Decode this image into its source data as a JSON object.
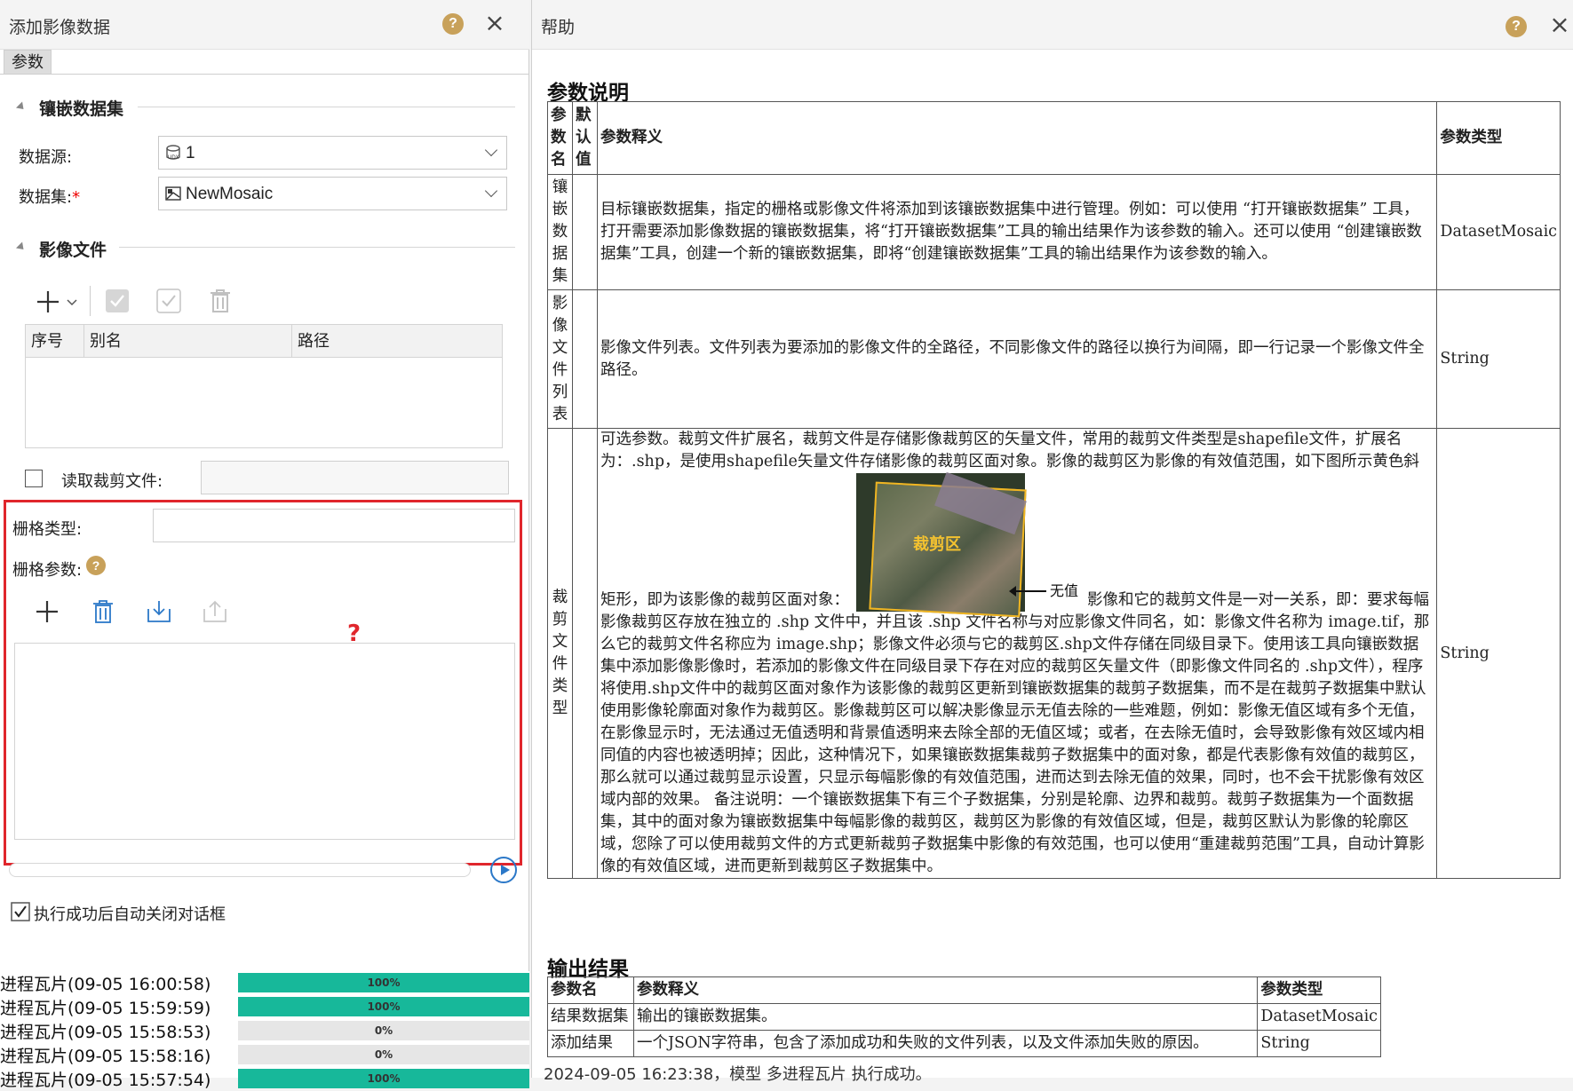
{
  "dialog": {
    "title": "添加影像数据",
    "tab": "参数",
    "mosaic_section": "镶嵌数据集",
    "datasource_label": "数据源:",
    "datasource_value": "1",
    "datasource_icon": "udx-datasource-icon",
    "dataset_label": "数据集:",
    "dataset_required": "*",
    "dataset_value": "NewMosaic",
    "dataset_icon": "mosaic-dataset-icon",
    "image_section": "影像文件",
    "file_grid_columns": [
      "序号",
      "别名",
      "路径"
    ],
    "read_clip_label": "读取裁剪文件:",
    "raster_type_label": "栅格类型:",
    "raster_params_label": "栅格参数:",
    "annotation_mark": "?",
    "auto_close_label": "执行成功后自动关闭对话框"
  },
  "tasks": [
    {
      "name": "进程瓦片(09-05 16:00:58)",
      "progress": 100,
      "label": "100%"
    },
    {
      "name": "进程瓦片(09-05 15:59:59)",
      "progress": 100,
      "label": "100%"
    },
    {
      "name": "进程瓦片(09-05 15:58:53)",
      "progress": 0,
      "label": "0%"
    },
    {
      "name": "进程瓦片(09-05 15:58:16)",
      "progress": 0,
      "label": "0%"
    },
    {
      "name": "进程瓦片(09-05 15:57:54)",
      "progress": 100,
      "label": "100%"
    }
  ],
  "help": {
    "title": "帮助",
    "params_heading": "参数说明",
    "params_headers": [
      "参数名",
      "默认值",
      "参数释义",
      "参数类型"
    ],
    "params": [
      {
        "name": "镶嵌数据集",
        "default": "",
        "type": "DatasetMosaic",
        "desc": "目标镶嵌数据集，指定的栅格或影像文件将添加到该镶嵌数据集中进行管理。例如：可以使用 “打开镶嵌数据集” 工具，打开需要添加影像数据的镶嵌数据集，将“打开镶嵌数据集”工具的输出结果作为该参数的输入。还可以使用 “创建镶嵌数据集”工具，创建一个新的镶嵌数据集，即将“创建镶嵌数据集”工具的输出结果作为该参数的输入。"
      },
      {
        "name": "影像文件列表",
        "default": "",
        "type": "String",
        "desc": "影像文件列表。文件列表为要添加的影像文件的全路径，不同影像文件的路径以换行为间隔，即一行记录一个影像文件全路径。"
      },
      {
        "name": "裁剪文件类型",
        "default": "",
        "type": "String",
        "desc_before": "可选参数。裁剪文件扩展名，裁剪文件是存储影像裁剪区的矢量文件，常用的裁剪文件类型是shapefile文件，扩展名为：.shp，是使用shapefile矢量文件存储影像的裁剪区面对象。影像的裁剪区为影像的有效值范围，如下图所示黄色斜矩形，即为该影像的裁剪区面对象：",
        "figure_label": "裁剪区",
        "figure_callout": "无值",
        "desc_after": "影像和它的裁剪文件是一对一关系，即：要求每幅影像裁剪区存放在独立的 .shp 文件中，并且该 .shp 文件名称与对应影像文件同名，如：影像文件名称为 image.tif，那么它的裁剪文件名称应为 image.shp；影像文件必须与它的裁剪区.shp文件存储在同级目录下。使用该工具向镶嵌数据集中添加影像影像时，若添加的影像文件在同级目录下存在对应的裁剪区矢量文件（即影像文件同名的 .shp文件），程序将使用.shp文件中的裁剪区面对象作为该影像的裁剪区更新到镶嵌数据集的裁剪子数据集，而不是在裁剪子数据集中默认使用影像轮廓面对象作为裁剪区。影像裁剪区可以解决影像显示无值去除的一些难题，例如：影像无值区域有多个无值，在影像显示时，无法通过无值透明和背景值透明来去除全部的无值区域；或者，在去除无值时，会导致影像有效区域内相同值的内容也被透明掉；因此，这种情况下，如果镶嵌数据集裁剪子数据集中的面对象，都是代表影像有效值的裁剪区，那么就可以通过裁剪显示设置，只显示每幅影像的有效值范围，进而达到去除无值的效果，同时，也不会干扰影像有效区域内部的效果。 备注说明：一个镶嵌数据集下有三个子数据集，分别是轮廓、边界和裁剪。裁剪子数据集为一个面数据集，其中的面对象为镶嵌数据集中每幅影像的裁剪区，裁剪区为影像的有效值区域，但是，裁剪区默认为影像的轮廓区域，您除了可以使用裁剪文件的方式更新裁剪子数据集中影像的有效范围，也可以使用“重建裁剪范围”工具，自动计算影像的有效值区域，进而更新到裁剪区子数据集中。"
      }
    ],
    "output_heading": "输出结果",
    "output_headers": [
      "参数名",
      "参数释义",
      "参数类型"
    ],
    "outputs": [
      {
        "name": "结果数据集",
        "desc": "输出的镶嵌数据集。",
        "type": "DatasetMosaic"
      },
      {
        "name": "添加结果",
        "desc": "一个JSON字符串，包含了添加成功和失败的文件列表，以及文件添加失败的原因。",
        "type": "String"
      }
    ]
  },
  "status_line": "2024-09-05 16:23:38，模型 多进程瓦片 执行成功。",
  "colors": {
    "accent_teal": "#17b89a",
    "annotation_red": "#e0262c",
    "help_icon": "#c8a15a"
  }
}
